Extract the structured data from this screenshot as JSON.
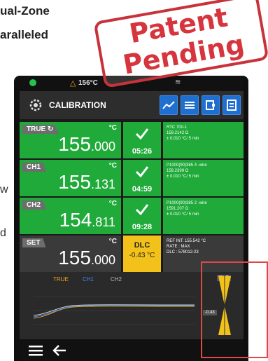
{
  "page": {
    "headline_line1": "ual-Zone",
    "headline_line2": "aralleled",
    "side_w": "w",
    "side_d": "d"
  },
  "stamp": {
    "line1": "Patent",
    "line2": "Pending"
  },
  "status_bar": {
    "temp": "156°C"
  },
  "header": {
    "title": "CALIBRATION"
  },
  "rows": [
    {
      "tag": "TRUE",
      "unit": "°C",
      "int": "155",
      "dec": ".000",
      "time": "05:26",
      "info": [
        "RTC 700-1",
        "159.2142 Ω",
        "± 0.010 °C/ 5 min"
      ]
    },
    {
      "tag": "CH1",
      "unit": "°C",
      "int": "155",
      "dec": ".131",
      "time": "04:59",
      "info": [
        "P1000(90)385 4 -wire",
        "159.2399 Ω",
        "± 0.010 °C/ 5 min"
      ]
    },
    {
      "tag": "CH2",
      "unit": "°C",
      "int": "154",
      "dec": ".811",
      "time": "09:28",
      "info": [
        "P1000(90)385 2 -wire",
        "1591.207 Ω",
        "± 0.010 °C/ 5 min"
      ]
    },
    {
      "tag": "SET",
      "unit": "°C",
      "int": "155",
      "dec": ".000",
      "dlc_label": "DLC",
      "dlc_value": "-0.43 °C",
      "info": [
        "REF INT: 155.542 °C",
        "RATE : MAX",
        "DLC : 578012-23"
      ]
    }
  ],
  "graph": {
    "legend": [
      "TRUE",
      "CH1",
      "CH2"
    ],
    "dlc_label": "DLC",
    "dlc_marker": "-0.43"
  },
  "colors": {
    "green": "#1faa3a",
    "yellow": "#f2c21b",
    "stamp_red": "#d6353d",
    "blue": "#1f6fd1"
  }
}
